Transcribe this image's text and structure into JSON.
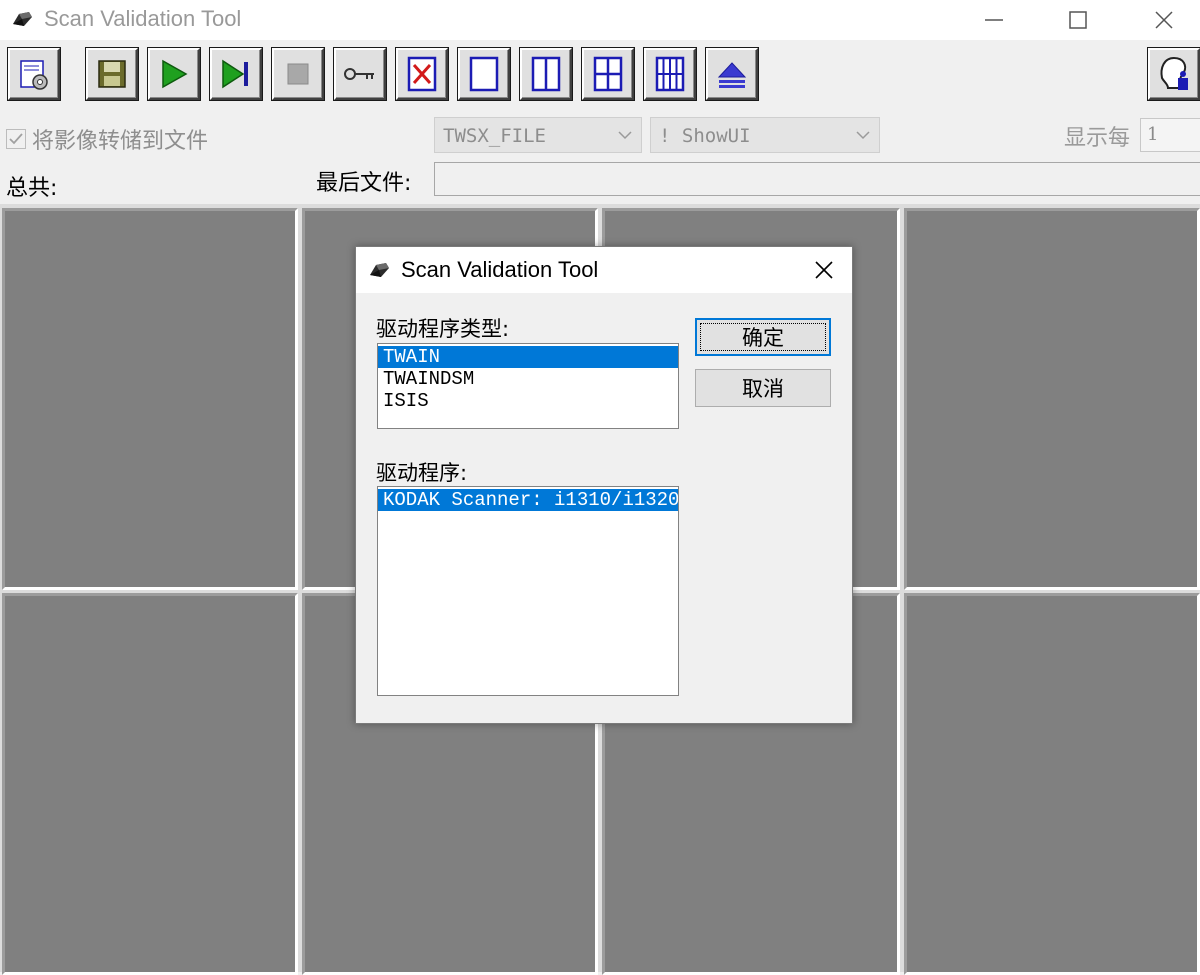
{
  "window": {
    "title": "Scan Validation Tool",
    "controls": [
      "minimize",
      "maximize",
      "close"
    ]
  },
  "toolbar": {
    "buttons": [
      {
        "icon": "settings-icon"
      },
      {
        "icon": "save-icon"
      },
      {
        "icon": "play-icon"
      },
      {
        "icon": "step-forward-icon"
      },
      {
        "icon": "stop-icon"
      },
      {
        "icon": "key-icon"
      },
      {
        "icon": "clear-icon"
      },
      {
        "icon": "layout-1-icon"
      },
      {
        "icon": "layout-2-icon"
      },
      {
        "icon": "layout-4-icon"
      },
      {
        "icon": "layout-8-icon"
      },
      {
        "icon": "eject-icon"
      },
      {
        "icon": "help-icon"
      }
    ]
  },
  "options": {
    "dump_to_file_label": "将影像转储到文件",
    "dump_to_file_checked": true,
    "format_combo_value": "TWSX_FILE",
    "ui_combo_value": "! ShowUI",
    "show_every_label": "显示每",
    "show_every_value": "1"
  },
  "status": {
    "total_label": "总共:",
    "last_file_label": "最后文件:",
    "last_file_value": ""
  },
  "colors": {
    "selection": "#0078d7",
    "tile_gray": "#808080",
    "play_green": "#1fa01f",
    "icon_blue": "#1c1cb4"
  },
  "dialog": {
    "title": "Scan Validation Tool",
    "driver_type_label": "驱动程序类型:",
    "driver_types": [
      {
        "label": "TWAIN",
        "selected": true
      },
      {
        "label": "TWAINDSM",
        "selected": false
      },
      {
        "label": "ISIS",
        "selected": false
      }
    ],
    "driver_label": "驱动程序:",
    "drivers": [
      {
        "label": "KODAK Scanner: i1310/i1320",
        "selected": true
      }
    ],
    "ok_label": "确定",
    "cancel_label": "取消"
  }
}
